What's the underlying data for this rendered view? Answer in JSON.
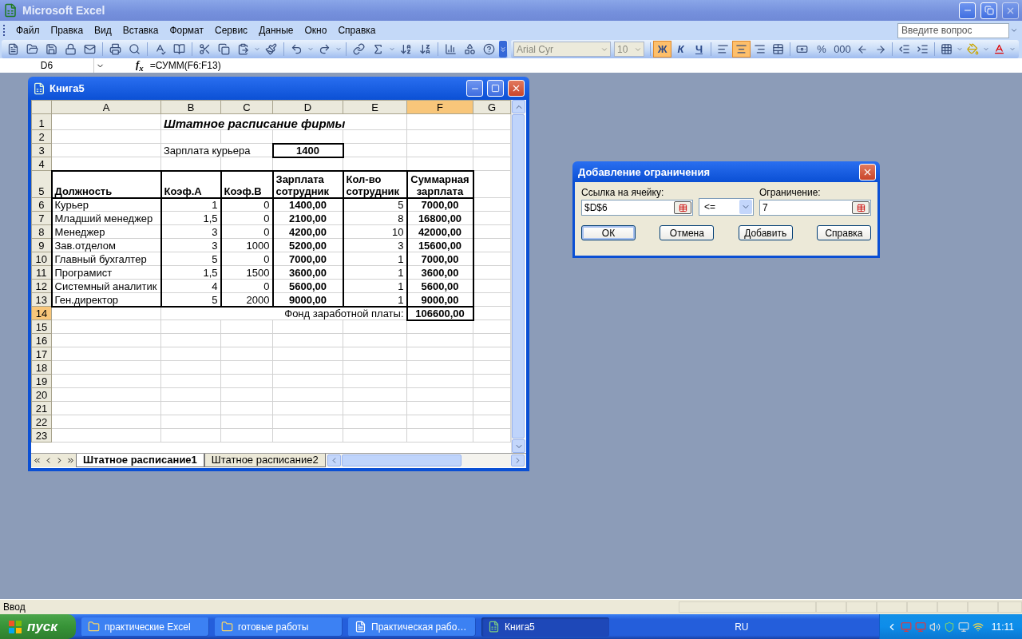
{
  "app": {
    "title": "Microsoft Excel"
  },
  "menu": [
    "Файл",
    "Правка",
    "Вид",
    "Вставка",
    "Формат",
    "Сервис",
    "Данные",
    "Окно",
    "Справка"
  ],
  "help_box": {
    "placeholder": "Введите вопрос"
  },
  "font": {
    "name": "Arial Cyr",
    "size": "10"
  },
  "style_buttons": [
    {
      "label": "Ж",
      "selected": true
    },
    {
      "label": "К",
      "selected": false
    },
    {
      "label": "Ч",
      "selected": false
    }
  ],
  "align_buttons": [
    {
      "kind": "left",
      "selected": false
    },
    {
      "kind": "center",
      "selected": true
    },
    {
      "kind": "right",
      "selected": false
    }
  ],
  "number_buttons": [
    "%",
    "000"
  ],
  "formula_bar": {
    "name_box": "D6",
    "fx": "f$_{x}$",
    "formula": "=СУММ(F6:F13)"
  },
  "workbook": {
    "title": "Книга5",
    "columns": [
      {
        "label": "A",
        "selected": false
      },
      {
        "label": "B",
        "selected": false
      },
      {
        "label": "C",
        "selected": false
      },
      {
        "label": "D",
        "selected": false
      },
      {
        "label": "E",
        "selected": false
      },
      {
        "label": "F",
        "selected": true
      },
      {
        "label": "G",
        "selected": false
      }
    ],
    "rows": [
      {
        "label": "1",
        "selected": false,
        "cells": [
          {},
          {
            "text": "Штатное расписание фирмы",
            "bold": true,
            "italic": true,
            "large": true
          },
          {
            "covered": true
          },
          {
            "covered": true
          },
          {
            "covered": true
          },
          {},
          {}
        ]
      },
      {
        "label": "2",
        "selected": false
      },
      {
        "label": "3",
        "selected": false,
        "cells": [
          {},
          {
            "text": "Зарплата курьера"
          },
          {
            "covered": true
          },
          {
            "text": "1400",
            "bold": true,
            "centered": true,
            "kind": "box"
          },
          {},
          {},
          {}
        ]
      },
      {
        "label": "4",
        "selected": false
      },
      {
        "label": "5",
        "selected": false,
        "cells": [
          {
            "text": "Должность",
            "bold": true,
            "kind": "box"
          },
          {
            "text": "Коэф.А",
            "bold": true,
            "kind": "box"
          },
          {
            "text": "Коэф.В",
            "bold": true,
            "kind": "box"
          },
          {
            "text": "Зарплата сотрудник",
            "bold": true,
            "kind": "box"
          },
          {
            "text": "Кол-во сотрудник",
            "bold": true,
            "kind": "box"
          },
          {
            "text": "Суммарная зарплата",
            "bold": true,
            "centered": true,
            "kind": "box"
          },
          {}
        ]
      },
      {
        "label": "6",
        "selected": false,
        "cells": [
          {
            "text": "Курьер",
            "kind": "side"
          },
          {
            "text": "1",
            "right_aligned": true,
            "kind": "side"
          },
          {
            "text": "0",
            "right_aligned": true,
            "kind": "side"
          },
          {
            "text": "1400,00",
            "bold": true,
            "centered": true,
            "kind": "side"
          },
          {
            "text": "5",
            "right_aligned": true,
            "kind": "side"
          },
          {
            "text": "7000,00",
            "bold": true,
            "centered": true,
            "kind": "side"
          },
          {}
        ]
      },
      {
        "label": "7",
        "selected": false,
        "cells": [
          {
            "text": "Младший менеджер",
            "kind": "side"
          },
          {
            "text": "1,5",
            "right_aligned": true,
            "kind": "side"
          },
          {
            "text": "0",
            "right_aligned": true,
            "kind": "side"
          },
          {
            "text": "2100,00",
            "bold": true,
            "centered": true,
            "kind": "side"
          },
          {
            "text": "8",
            "right_aligned": true,
            "kind": "side"
          },
          {
            "text": "16800,00",
            "bold": true,
            "centered": true,
            "kind": "side"
          },
          {}
        ]
      },
      {
        "label": "8",
        "selected": false,
        "cells": [
          {
            "text": "Менеджер",
            "kind": "side"
          },
          {
            "text": "3",
            "right_aligned": true,
            "kind": "side"
          },
          {
            "text": "0",
            "right_aligned": true,
            "kind": "side"
          },
          {
            "text": "4200,00",
            "bold": true,
            "centered": true,
            "kind": "side"
          },
          {
            "text": "10",
            "right_aligned": true,
            "kind": "side"
          },
          {
            "text": "42000,00",
            "bold": true,
            "centered": true,
            "kind": "side"
          },
          {}
        ]
      },
      {
        "label": "9",
        "selected": false,
        "cells": [
          {
            "text": "Зав.отделом",
            "kind": "side"
          },
          {
            "text": "3",
            "right_aligned": true,
            "kind": "side"
          },
          {
            "text": "1000",
            "right_aligned": true,
            "kind": "side"
          },
          {
            "text": "5200,00",
            "bold": true,
            "centered": true,
            "kind": "side"
          },
          {
            "text": "3",
            "right_aligned": true,
            "kind": "side"
          },
          {
            "text": "15600,00",
            "bold": true,
            "centered": true,
            "kind": "side"
          },
          {}
        ]
      },
      {
        "label": "10",
        "selected": false,
        "cells": [
          {
            "text": "Главный бухгалтер",
            "kind": "side"
          },
          {
            "text": "5",
            "right_aligned": true,
            "kind": "side"
          },
          {
            "text": "0",
            "right_aligned": true,
            "kind": "side"
          },
          {
            "text": "7000,00",
            "bold": true,
            "centered": true,
            "kind": "side"
          },
          {
            "text": "1",
            "right_aligned": true,
            "kind": "side"
          },
          {
            "text": "7000,00",
            "bold": true,
            "centered": true,
            "kind": "side"
          },
          {}
        ]
      },
      {
        "label": "11",
        "selected": false,
        "cells": [
          {
            "text": "Програмист",
            "kind": "side"
          },
          {
            "text": "1,5",
            "right_aligned": true,
            "kind": "side"
          },
          {
            "text": "1500",
            "right_aligned": true,
            "kind": "side"
          },
          {
            "text": "3600,00",
            "bold": true,
            "centered": true,
            "kind": "side"
          },
          {
            "text": "1",
            "right_aligned": true,
            "kind": "side"
          },
          {
            "text": "3600,00",
            "bold": true,
            "centered": true,
            "kind": "side"
          },
          {}
        ]
      },
      {
        "label": "12",
        "selected": false,
        "cells": [
          {
            "text": "Системный аналитик",
            "kind": "side"
          },
          {
            "text": "4",
            "right_aligned": true,
            "kind": "side"
          },
          {
            "text": "0",
            "right_aligned": true,
            "kind": "side"
          },
          {
            "text": "5600,00",
            "bold": true,
            "centered": true,
            "kind": "side"
          },
          {
            "text": "1",
            "right_aligned": true,
            "kind": "side"
          },
          {
            "text": "5600,00",
            "bold": true,
            "centered": true,
            "kind": "side"
          },
          {}
        ]
      },
      {
        "label": "13",
        "selected": false,
        "cells": [
          {
            "text": "Ген.директор",
            "kind": "base"
          },
          {
            "text": "5",
            "right_aligned": true,
            "kind": "base"
          },
          {
            "text": "2000",
            "right_aligned": true,
            "kind": "base"
          },
          {
            "text": "9000,00",
            "bold": true,
            "centered": true,
            "kind": "base"
          },
          {
            "text": "1",
            "right_aligned": true,
            "kind": "base"
          },
          {
            "text": "9000,00",
            "bold": true,
            "centered": true,
            "kind": "base"
          },
          {}
        ]
      },
      {
        "label": "14",
        "selected": true,
        "cells": [
          {},
          {
            "text": "Фонд заработной платы:",
            "right_aligned": true
          },
          {
            "covered": true
          },
          {
            "covered": true
          },
          {
            "covered": true
          },
          {
            "text": "106600,00",
            "bold": true,
            "centered": true,
            "kind": "box"
          },
          {}
        ]
      },
      {
        "label": "15",
        "selected": false
      },
      {
        "label": "16",
        "selected": false
      },
      {
        "label": "17",
        "selected": false
      },
      {
        "label": "18",
        "selected": false
      },
      {
        "label": "19",
        "selected": false
      },
      {
        "label": "20",
        "selected": false
      },
      {
        "label": "21",
        "selected": false
      },
      {
        "label": "22",
        "selected": false
      },
      {
        "label": "23",
        "selected": false
      }
    ],
    "sheets": [
      {
        "label": "Штатное расписание1",
        "selected": true
      },
      {
        "label": "Штатное расписание2",
        "selected": false
      }
    ]
  },
  "dialog": {
    "title": "Добавление ограничения",
    "cell_ref": {
      "label": "Ссылка на ячейку:",
      "value": "$D$6"
    },
    "operator": "<=",
    "constraint": {
      "label": "Ограничение:",
      "value": "7"
    },
    "buttons": [
      {
        "label": "ОК",
        "default": true
      },
      {
        "label": "Отмена",
        "default": false
      },
      {
        "label": "Добавить",
        "default": false
      },
      {
        "label": "Справка",
        "default": false
      }
    ]
  },
  "status_bar": {
    "text": "Ввод"
  },
  "taskbar": {
    "start": "пуск",
    "tasks": [
      {
        "label": "практические Excel",
        "kind": "folder",
        "selected": false
      },
      {
        "label": "готовые работы",
        "kind": "folder",
        "selected": false
      },
      {
        "label": "Практическая рабо…",
        "kind": "document",
        "selected": false
      },
      {
        "label": "Книга5",
        "kind": "spreadsheet",
        "selected": true
      }
    ],
    "language": "RU",
    "clock": "11:11"
  }
}
